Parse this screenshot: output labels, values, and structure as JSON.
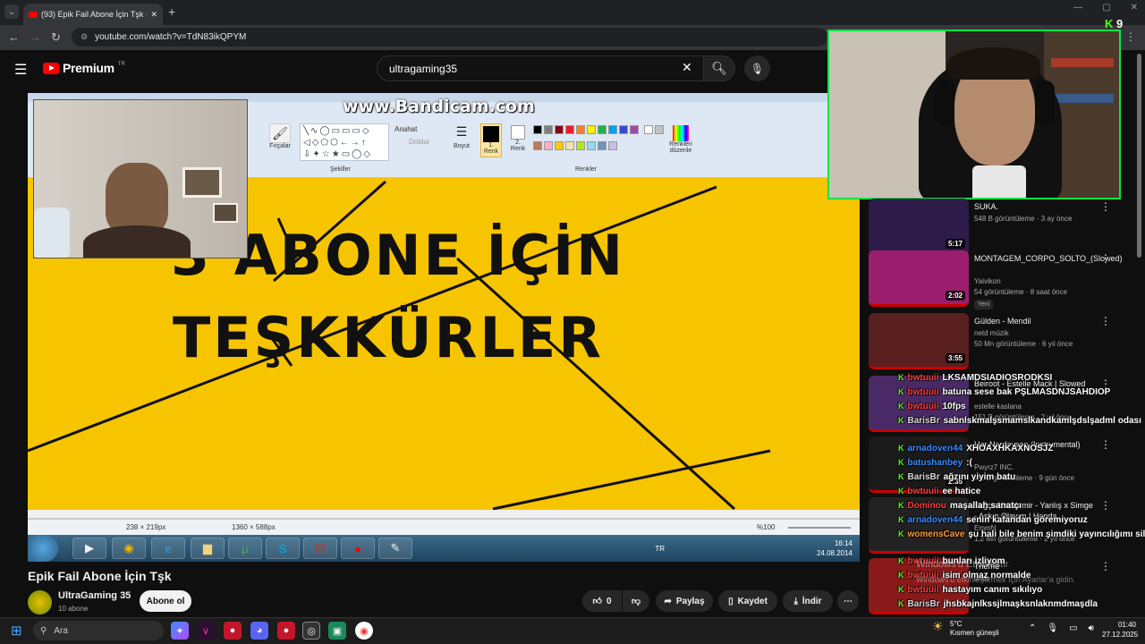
{
  "browser": {
    "tab_title": "(93) Epik Fail Abone İçin Tşk - Y",
    "url": "youtube.com/watch?v=TdN83ikQPYM",
    "new_tab": "+",
    "tab_list": "⌄"
  },
  "youtube": {
    "logo_text": "Premium",
    "logo_region": "TR",
    "search_value": "ultragaming35"
  },
  "video": {
    "watermark": "www.Bandicam.com",
    "canvas_line1": "3 ABONE İÇİN",
    "canvas_line2": "TEŞKKÜRLER",
    "ribbon_groups": [
      "Şekiller",
      "Renkler"
    ],
    "ribbon_labels": {
      "fircalar": "Fırçalar",
      "boyut": "Boyut",
      "renk1": "1. Renk",
      "renk2": "2. Renk",
      "renkleri": "Renkleri düzenle",
      "anahat": "Anahat",
      "doldur": "Doldur"
    },
    "status_dims1": "238 × 219px",
    "status_dims2": "1360 × 588px",
    "zoom": "%100",
    "xp_clock_time": "16:14",
    "xp_clock_date": "24.08.2014",
    "xp_lang": "TR"
  },
  "stream": {
    "viewer_count": "9"
  },
  "watch": {
    "title": "Epik Fail Abone İçin Tşk",
    "channel": "UltraGaming 35",
    "subscribers": "10 abone",
    "subscribe_label": "Abone ol",
    "like_count": "0",
    "share_label": "Paylaş",
    "save_label": "Kaydet",
    "download_label": "İndir"
  },
  "sidebar": [
    {
      "title": "SUKA.",
      "channel": "",
      "meta": "548 B görüntüleme · 3 ay önce",
      "duration": "5:17",
      "color": "#2d1b4a"
    },
    {
      "title": "MONTAGEM_CORPO_SOLTO_(Slowed)",
      "channel": "Yaivikon",
      "meta": "54 görüntüleme · 8 saat önce",
      "duration": "2:02",
      "badge": "Yeni",
      "color": "#9b1e6e"
    },
    {
      "title": "Gülden - Mendil",
      "channel": "netd müzik",
      "meta": "50 Mn görüntüleme · 6 yıl önce",
      "duration": "3:55",
      "color": "#5a1f1f"
    },
    {
      "title": "Beiroot - Estelle Mack | Slowed",
      "channel": "estelle kaslana",
      "meta": "151 B görüntüleme · 2 yıl önce",
      "duration": "",
      "color": "#4a2a66"
    },
    {
      "title": "Her Nerdeysen (Instrumental)",
      "channel": "Pwyrz7 INC.",
      "meta": "7,2 B görüntüleme · 9 gün önce",
      "duration": "2:35",
      "color": "#1a1a1a"
    },
    {
      "title": "Tuğçe Kandemir - Yanlış x Simge - Aşkın Olayım | Honda",
      "channel": "EmmN",
      "meta": "1,2 Mn görüntüleme · 2 yıl önce",
      "duration": "",
      "color": "#222"
    },
    {
      "title": "Theme",
      "channel": "",
      "meta": "önce",
      "duration": "",
      "color": "#8a1a1a"
    }
  ],
  "chat": [
    {
      "user": "bwtuuii",
      "color": "#ff3b3b",
      "msg": "LKSAMDSIADIOSRODKSI"
    },
    {
      "user": "bwtuuii",
      "color": "#ff3b3b",
      "msg": "batuna sese bak PŞLMASDNJSAHDIOP"
    },
    {
      "user": "bwtuuii",
      "color": "#ff3b3b",
      "msg": "10fps"
    },
    {
      "user": "BarisBr",
      "color": "#d9d9d9",
      "msg": "sabnlskmalşsmamslkandkamlşdslşadml odası"
    },
    {
      "user": "arnadoven44",
      "color": "#3a8bff",
      "msg": "XHOAXHKAXNOSJZ"
    },
    {
      "user": "batushanbey",
      "color": "#3a8bff",
      "msg": ":("
    },
    {
      "user": "BarisBr",
      "color": "#d9d9d9",
      "msg": "ağzını yiyim batu"
    },
    {
      "user": "bwtuuii",
      "color": "#ff3b3b",
      "msg": "ee hatice"
    },
    {
      "user": "Dominou",
      "color": "#ff3b3b",
      "msg": "maşallah sanatçı"
    },
    {
      "user": "arnadoven44",
      "color": "#3a8bff",
      "msg": "senin kafandan göremiyoruz"
    },
    {
      "user": "womensCave",
      "color": "#ff9a3a",
      "msg": "şu hali bile benim şimdiki yayıncılığımı siler"
    },
    {
      "user": "bwtuuii",
      "color": "#ff3b3b",
      "msg": "bunları izliyom"
    },
    {
      "user": "bwtuuii",
      "color": "#ff3b3b",
      "msg": "isim olmaz normalde"
    },
    {
      "user": "bwtuuii",
      "color": "#ff3b3b",
      "msg": "hastayım canım sıkılıyo"
    },
    {
      "user": "BarisBr",
      "color": "#d9d9d9",
      "msg": "jhsbkajnlkssjlmaşksnlaknmdmaşdla"
    }
  ],
  "windows": {
    "activation_line1": "Windows'u Etkinleştir",
    "activation_line2": "Windows'u etkinleştirmek için Ayarlar'a gidin.",
    "search_placeholder": "Ara",
    "weather_temp": "5°C",
    "weather_desc": "Kısmen güneşli",
    "time": "01:40",
    "date": "27.12.2025"
  }
}
